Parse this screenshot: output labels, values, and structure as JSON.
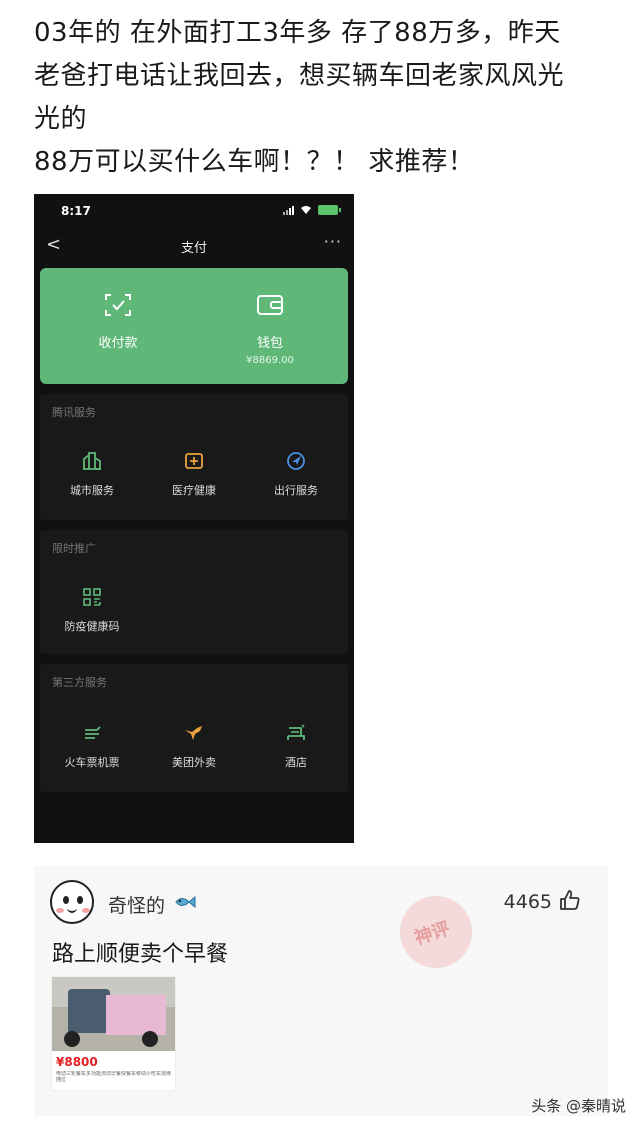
{
  "post": {
    "lines": [
      "03年的   在外面打工3年多  存了88万多，昨天",
      "老爸打电话让我回去，想买辆车回老家风风光",
      "光的",
      "88万可以买什么车啊！？！ 求推荐！"
    ]
  },
  "phone": {
    "status": {
      "time": "8:17"
    },
    "nav": {
      "back": "<",
      "title": "支付",
      "more": "···"
    },
    "wallet_card": {
      "pay_label": "收付款",
      "wallet_label": "钱包",
      "wallet_balance": "¥8869.00",
      "color": "#5fb878"
    },
    "sections": [
      {
        "title": "腾讯服务",
        "items": [
          {
            "label": "城市服务",
            "icon": "city-service-icon"
          },
          {
            "label": "医疗健康",
            "icon": "medical-icon"
          },
          {
            "label": "出行服务",
            "icon": "travel-icon"
          }
        ]
      },
      {
        "title": "限时推广",
        "items": [
          {
            "label": "防疫健康码",
            "icon": "health-code-icon"
          }
        ]
      },
      {
        "title": "第三方服务",
        "items": [
          {
            "label": "火车票机票",
            "icon": "train-ticket-icon"
          },
          {
            "label": "美团外卖",
            "icon": "meituan-icon"
          },
          {
            "label": "酒店",
            "icon": "hotel-icon"
          }
        ]
      }
    ]
  },
  "comment": {
    "username": "奇怪的",
    "likes": "4465",
    "text": "路上顺便卖个早餐",
    "stamp": "神评",
    "product": {
      "price": "¥8800",
      "desc": "电动三轮餐车多功能流动早餐快餐车移动小吃车烧烤摊位"
    }
  },
  "watermark": "头条 @秦晴说"
}
